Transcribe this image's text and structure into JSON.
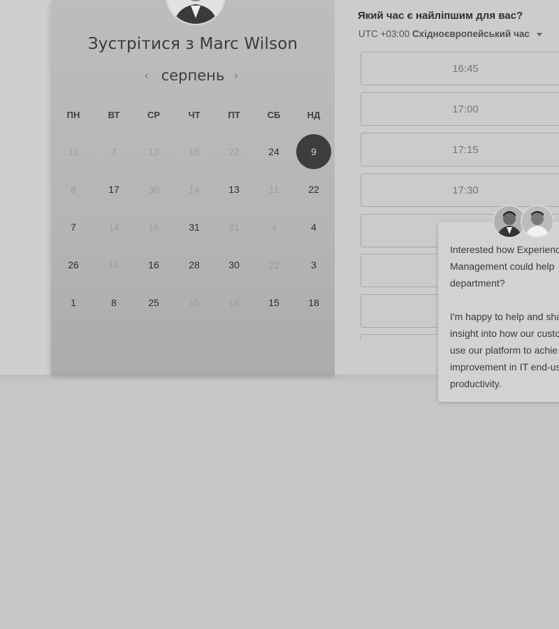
{
  "booking": {
    "title": "Зустрітися з Marc Wilson",
    "month": "серпень",
    "prev_icon": "‹",
    "next_icon": "›",
    "weekdays": [
      "ПН",
      "ВТ",
      "СР",
      "ЧТ",
      "ПТ",
      "СБ",
      "НД"
    ],
    "weeks": [
      [
        {
          "d": "11",
          "state": "off"
        },
        {
          "d": "7",
          "state": "off"
        },
        {
          "d": "13",
          "state": "off"
        },
        {
          "d": "16",
          "state": "off"
        },
        {
          "d": "22",
          "state": "off"
        },
        {
          "d": "24",
          "state": "on"
        },
        {
          "d": "9",
          "state": "selected"
        }
      ],
      [
        {
          "d": "8",
          "state": "off"
        },
        {
          "d": "17",
          "state": "on"
        },
        {
          "d": "30",
          "state": "off"
        },
        {
          "d": "14",
          "state": "off"
        },
        {
          "d": "13",
          "state": "on"
        },
        {
          "d": "11",
          "state": "off"
        },
        {
          "d": "22",
          "state": "on"
        }
      ],
      [
        {
          "d": "7",
          "state": "on"
        },
        {
          "d": "14",
          "state": "off"
        },
        {
          "d": "16",
          "state": "off"
        },
        {
          "d": "31",
          "state": "on"
        },
        {
          "d": "31",
          "state": "off"
        },
        {
          "d": "4",
          "state": "off"
        },
        {
          "d": "4",
          "state": "on"
        }
      ],
      [
        {
          "d": "26",
          "state": "on"
        },
        {
          "d": "14",
          "state": "off"
        },
        {
          "d": "16",
          "state": "on"
        },
        {
          "d": "28",
          "state": "on"
        },
        {
          "d": "30",
          "state": "on"
        },
        {
          "d": "22",
          "state": "off"
        },
        {
          "d": "3",
          "state": "on"
        }
      ],
      [
        {
          "d": "1",
          "state": "on"
        },
        {
          "d": "8",
          "state": "on"
        },
        {
          "d": "25",
          "state": "on"
        },
        {
          "d": "15",
          "state": "off"
        },
        {
          "d": "18",
          "state": "off"
        },
        {
          "d": "15",
          "state": "on"
        },
        {
          "d": "18",
          "state": "on"
        }
      ]
    ]
  },
  "times": {
    "question": "Який час є найліпшим для вас?",
    "timezone_offset": "UTC +03:00",
    "timezone_name": "Східноєвропейський час",
    "slots": [
      "16:45",
      "17:00",
      "17:15",
      "17:30",
      "",
      "",
      ""
    ]
  },
  "chat": {
    "paragraph1": [
      "Interested how Experienc",
      "Management could help",
      "department?"
    ],
    "paragraph2": [
      "I'm happy to help and sha",
      "insight into how our custo",
      "use our platform to achie",
      "improvement in IT end-us",
      "productivity."
    ]
  },
  "colors": {
    "selected_day": "#3d3d3d",
    "page_background": "#c6c6c6"
  }
}
